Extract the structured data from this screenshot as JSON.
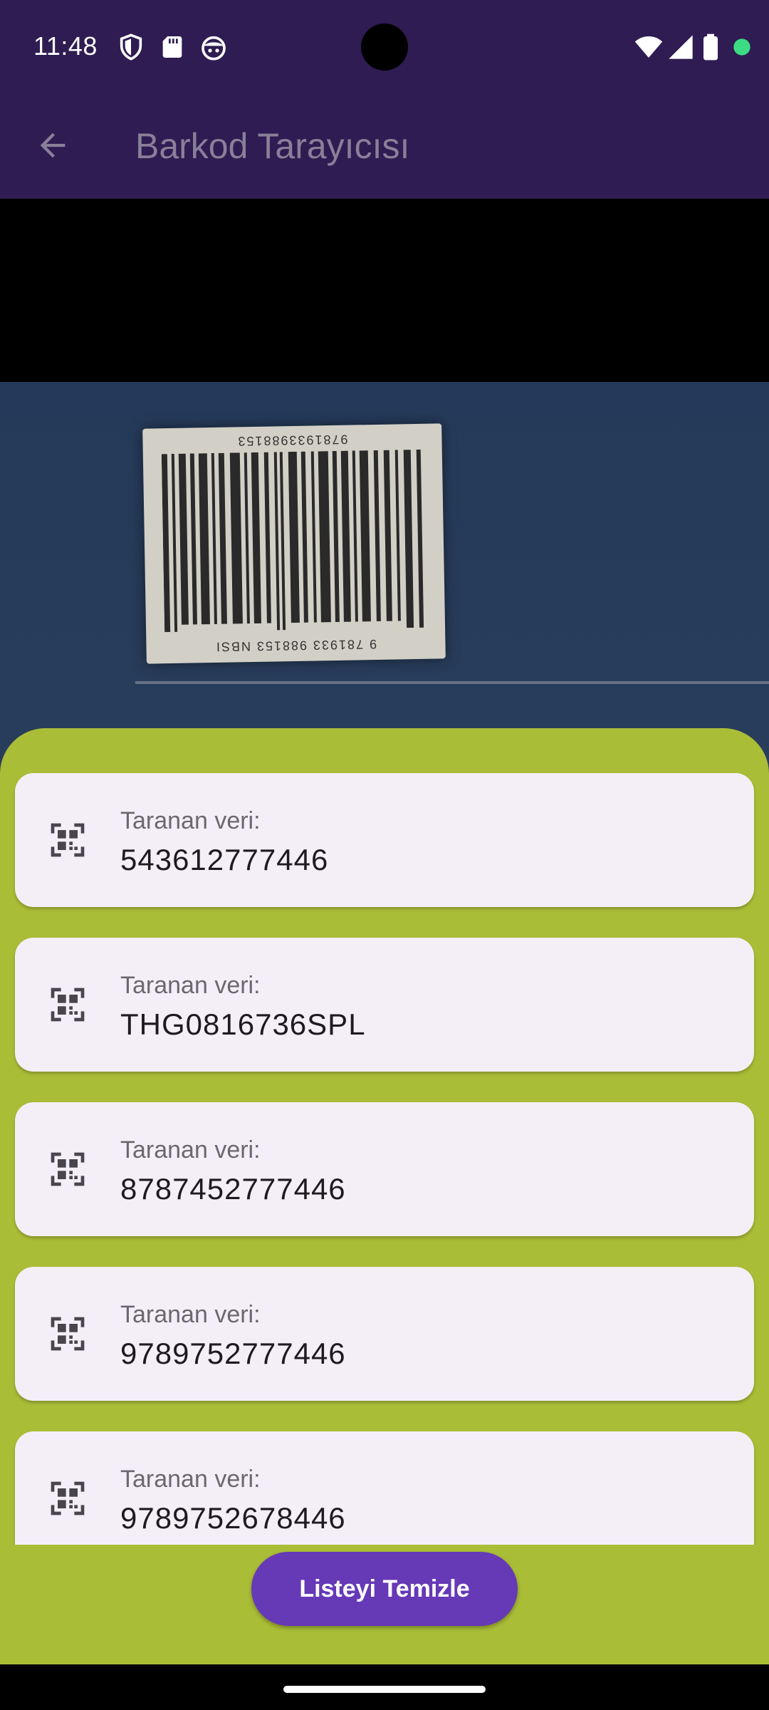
{
  "status_bar": {
    "time": "11:48",
    "left_icons": [
      "shield-icon",
      "sd-card-icon",
      "android-face-icon"
    ],
    "right_icons": [
      "wifi-icon",
      "cellular-signal-icon",
      "battery-icon",
      "privacy-dot-icon"
    ],
    "privacy_dot_color": "#3ddc84"
  },
  "app_bar": {
    "title": "Barkod Tarayıcısı",
    "back_icon": "arrow-back-icon",
    "background": "#2e1c52"
  },
  "camera": {
    "barcode_top_text": "9781933988153",
    "barcode_bottom_text": "9 781933 988153 NBSI"
  },
  "scans": [
    {
      "label": "Taranan veri:",
      "value": "543612777446",
      "icon": "qr-code-scanner-icon"
    },
    {
      "label": "Taranan veri:",
      "value": "THG0816736SPL",
      "icon": "qr-code-scanner-icon"
    },
    {
      "label": "Taranan veri:",
      "value": "8787452777446",
      "icon": "qr-code-scanner-icon"
    },
    {
      "label": "Taranan veri:",
      "value": "9789752777446",
      "icon": "qr-code-scanner-icon"
    },
    {
      "label": "Taranan veri:",
      "value": "9789752678446",
      "icon": "qr-code-scanner-icon"
    }
  ],
  "actions": {
    "clear_label": "Listeyi Temizle",
    "clear_color": "#6639b7"
  },
  "colors": {
    "sheet": "#b1c435",
    "card": "#f4eff6"
  }
}
